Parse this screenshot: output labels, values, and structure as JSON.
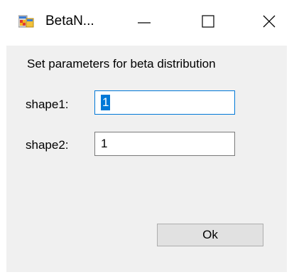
{
  "window": {
    "title": "BetaN...",
    "icon": "windows-forms-app-icon"
  },
  "caption_buttons": {
    "minimize": "minimize-icon",
    "maximize": "maximize-icon",
    "close": "close-icon"
  },
  "form": {
    "prompt": "Set parameters for beta distribution",
    "shape1": {
      "label": "shape1:",
      "value": "1"
    },
    "shape2": {
      "label": "shape2:",
      "value": "1"
    },
    "ok_label": "Ok"
  },
  "colors": {
    "client_background": "#f0f0f0",
    "focus_border": "#0078d7",
    "selection": "#0078d7",
    "button_face": "#e1e1e1"
  }
}
